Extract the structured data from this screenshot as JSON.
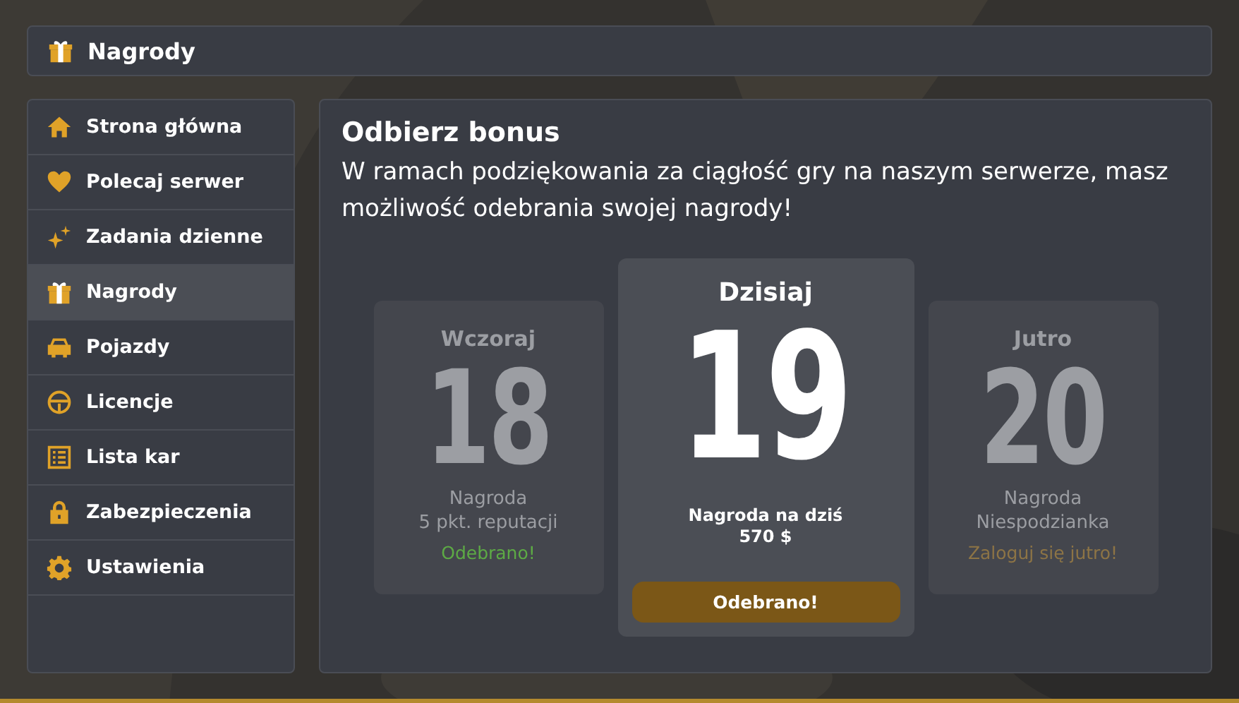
{
  "header": {
    "title": "Nagrody"
  },
  "sidebar": {
    "items": [
      {
        "label": "Strona główna",
        "selected": false
      },
      {
        "label": "Polecaj serwer",
        "selected": false
      },
      {
        "label": "Zadania dzienne",
        "selected": false
      },
      {
        "label": "Nagrody",
        "selected": true
      },
      {
        "label": "Pojazdy",
        "selected": false
      },
      {
        "label": "Licencje",
        "selected": false
      },
      {
        "label": "Lista kar",
        "selected": false
      },
      {
        "label": "Zabezpieczenia",
        "selected": false
      },
      {
        "label": "Ustawienia",
        "selected": false
      }
    ]
  },
  "main": {
    "title": "Odbierz bonus",
    "description": "W ramach podziękowania za ciągłość gry na naszym serwerze, masz możliwość odebrania swojej nagrody!",
    "days": [
      {
        "kind": "past",
        "label": "Wczoraj",
        "day": "18",
        "reward_title": "Nagroda",
        "reward": "5 pkt. reputacji",
        "status": "Odebrano!"
      },
      {
        "kind": "today",
        "label": "Dzisiaj",
        "day": "19",
        "reward_title": "Nagroda na dziś",
        "reward": "570 $",
        "status": "Odebrano!"
      },
      {
        "kind": "future",
        "label": "Jutro",
        "day": "20",
        "reward_title": "Nagroda",
        "reward": "Niespodzianka",
        "status": "Zaloguj się jutro!"
      }
    ]
  }
}
